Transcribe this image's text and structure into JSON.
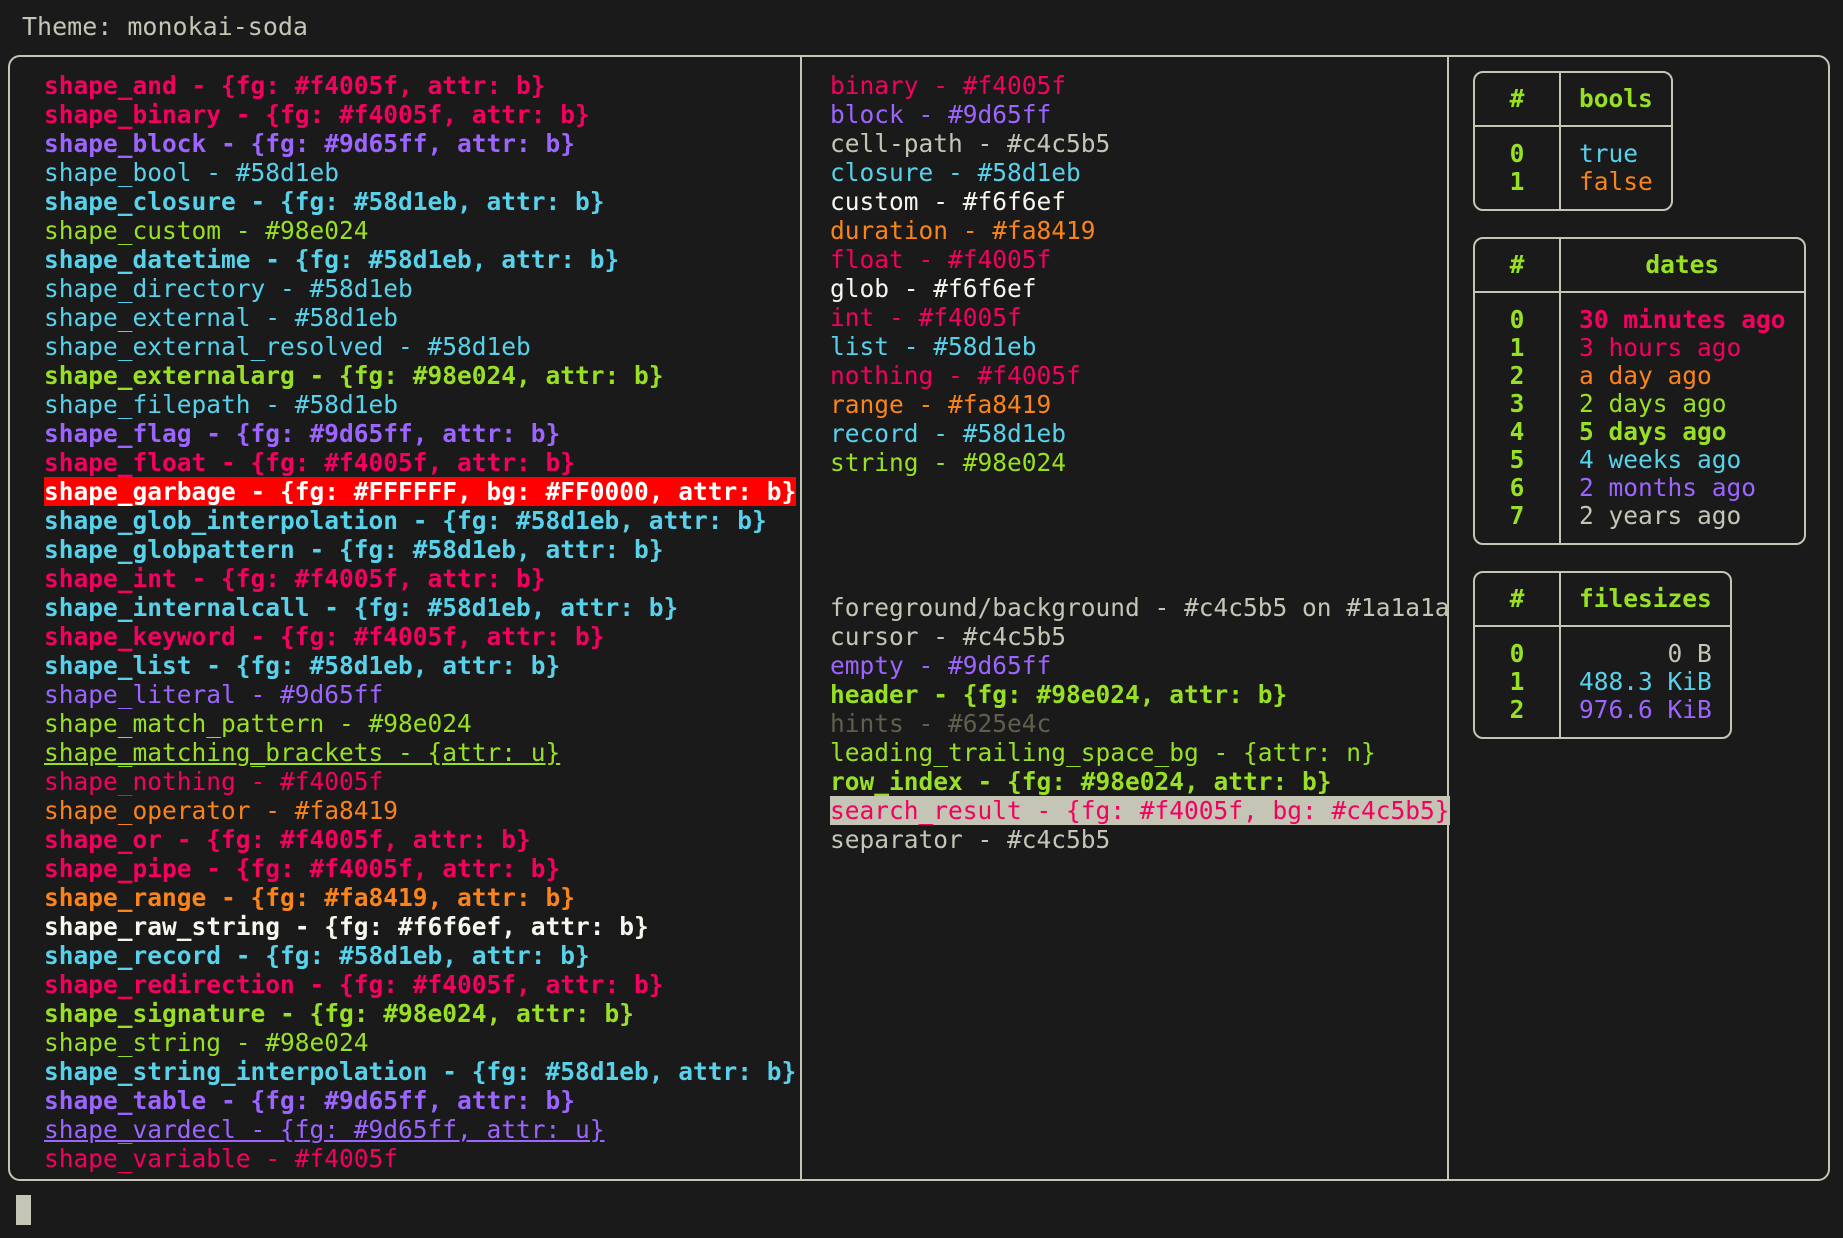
{
  "header": {
    "theme_label": "Theme: monokai-soda"
  },
  "colors": {
    "bg": "#1a1a1a",
    "fg": "#c4c5b5",
    "red": "#f4005f",
    "purple": "#9d65ff",
    "cyan": "#58d1eb",
    "green": "#98e024",
    "orange": "#fa8419",
    "white": "#f6f6ef",
    "hint_grey": "#625e4c",
    "garbage_fg": "#FFFFFF",
    "garbage_bg": "#FF0000"
  },
  "shapes_column": [
    {
      "name": "shape_and",
      "sep": " - ",
      "value": "{fg: #f4005f, attr: b}",
      "color": "red",
      "bold": true,
      "underline": false
    },
    {
      "name": "shape_binary",
      "sep": " - ",
      "value": "{fg: #f4005f, attr: b}",
      "color": "red",
      "bold": true,
      "underline": false
    },
    {
      "name": "shape_block",
      "sep": " - ",
      "value": "{fg: #9d65ff, attr: b}",
      "color": "purple",
      "bold": true,
      "underline": false
    },
    {
      "name": "shape_bool",
      "sep": " - ",
      "value": "#58d1eb",
      "color": "cyan",
      "bold": false,
      "underline": false
    },
    {
      "name": "shape_closure",
      "sep": " - ",
      "value": "{fg: #58d1eb, attr: b}",
      "color": "cyan",
      "bold": true,
      "underline": false
    },
    {
      "name": "shape_custom",
      "sep": " - ",
      "value": "#98e024",
      "color": "green",
      "bold": false,
      "underline": false
    },
    {
      "name": "shape_datetime",
      "sep": " - ",
      "value": "{fg: #58d1eb, attr: b}",
      "color": "cyan",
      "bold": true,
      "underline": false
    },
    {
      "name": "shape_directory",
      "sep": " - ",
      "value": "#58d1eb",
      "color": "cyan",
      "bold": false,
      "underline": false
    },
    {
      "name": "shape_external",
      "sep": " - ",
      "value": "#58d1eb",
      "color": "cyan",
      "bold": false,
      "underline": false
    },
    {
      "name": "shape_external_resolved",
      "sep": " - ",
      "value": "#58d1eb",
      "color": "cyan",
      "bold": false,
      "underline": false
    },
    {
      "name": "shape_externalarg",
      "sep": " - ",
      "value": "{fg: #98e024, attr: b}",
      "color": "green",
      "bold": true,
      "underline": false
    },
    {
      "name": "shape_filepath",
      "sep": " - ",
      "value": "#58d1eb",
      "color": "cyan",
      "bold": false,
      "underline": false
    },
    {
      "name": "shape_flag",
      "sep": " - ",
      "value": "{fg: #9d65ff, attr: b}",
      "color": "purple",
      "bold": true,
      "underline": false
    },
    {
      "name": "shape_float",
      "sep": " - ",
      "value": "{fg: #f4005f, attr: b}",
      "color": "red",
      "bold": true,
      "underline": false
    },
    {
      "name": "shape_garbage",
      "sep": " - ",
      "value": "{fg: #FFFFFF, bg: #FF0000, attr: b}",
      "color": "garbage",
      "bold": true,
      "underline": false
    },
    {
      "name": "shape_glob_interpolation",
      "sep": " - ",
      "value": "{fg: #58d1eb, attr: b}",
      "color": "cyan",
      "bold": true,
      "underline": false
    },
    {
      "name": "shape_globpattern",
      "sep": " - ",
      "value": "{fg: #58d1eb, attr: b}",
      "color": "cyan",
      "bold": true,
      "underline": false
    },
    {
      "name": "shape_int",
      "sep": " - ",
      "value": "{fg: #f4005f, attr: b}",
      "color": "red",
      "bold": true,
      "underline": false
    },
    {
      "name": "shape_internalcall",
      "sep": " - ",
      "value": "{fg: #58d1eb, attr: b}",
      "color": "cyan",
      "bold": true,
      "underline": false
    },
    {
      "name": "shape_keyword",
      "sep": " - ",
      "value": "{fg: #f4005f, attr: b}",
      "color": "red",
      "bold": true,
      "underline": false
    },
    {
      "name": "shape_list",
      "sep": " - ",
      "value": "{fg: #58d1eb, attr: b}",
      "color": "cyan",
      "bold": true,
      "underline": false
    },
    {
      "name": "shape_literal",
      "sep": " - ",
      "value": "#9d65ff",
      "color": "purple",
      "bold": false,
      "underline": false
    },
    {
      "name": "shape_match_pattern",
      "sep": " - ",
      "value": "#98e024",
      "color": "green",
      "bold": false,
      "underline": false
    },
    {
      "name": "shape_matching_brackets",
      "sep": " - ",
      "value": "{attr: u}",
      "color": "green",
      "bold": false,
      "underline": true
    },
    {
      "name": "shape_nothing",
      "sep": " - ",
      "value": "#f4005f",
      "color": "red",
      "bold": false,
      "underline": false
    },
    {
      "name": "shape_operator",
      "sep": " - ",
      "value": "#fa8419",
      "color": "orange",
      "bold": false,
      "underline": false
    },
    {
      "name": "shape_or",
      "sep": " - ",
      "value": "{fg: #f4005f, attr: b}",
      "color": "red",
      "bold": true,
      "underline": false
    },
    {
      "name": "shape_pipe",
      "sep": " - ",
      "value": "{fg: #f4005f, attr: b}",
      "color": "red",
      "bold": true,
      "underline": false
    },
    {
      "name": "shape_range",
      "sep": " - ",
      "value": "{fg: #fa8419, attr: b}",
      "color": "orange",
      "bold": true,
      "underline": false
    },
    {
      "name": "shape_raw_string",
      "sep": " - ",
      "value": "{fg: #f6f6ef, attr: b}",
      "color": "white",
      "bold": true,
      "underline": false
    },
    {
      "name": "shape_record",
      "sep": " - ",
      "value": "{fg: #58d1eb, attr: b}",
      "color": "cyan",
      "bold": true,
      "underline": false
    },
    {
      "name": "shape_redirection",
      "sep": " - ",
      "value": "{fg: #f4005f, attr: b}",
      "color": "red",
      "bold": true,
      "underline": false
    },
    {
      "name": "shape_signature",
      "sep": " - ",
      "value": "{fg: #98e024, attr: b}",
      "color": "green",
      "bold": true,
      "underline": false
    },
    {
      "name": "shape_string",
      "sep": " - ",
      "value": "#98e024",
      "color": "green",
      "bold": false,
      "underline": false
    },
    {
      "name": "shape_string_interpolation",
      "sep": " - ",
      "value": "{fg: #58d1eb, attr: b}",
      "color": "cyan",
      "bold": true,
      "underline": false
    },
    {
      "name": "shape_table",
      "sep": " - ",
      "value": "{fg: #9d65ff, attr: b}",
      "color": "purple",
      "bold": true,
      "underline": false
    },
    {
      "name": "shape_vardecl",
      "sep": " - ",
      "value": "{fg: #9d65ff, attr: u}",
      "color": "purple",
      "bold": false,
      "underline": true
    },
    {
      "name": "shape_variable",
      "sep": " - ",
      "value": "#f4005f",
      "color": "red",
      "bold": false,
      "underline": false
    }
  ],
  "types_column": [
    {
      "name": "binary",
      "sep": " - ",
      "value": "#f4005f",
      "color": "red",
      "bold": false,
      "underline": false
    },
    {
      "name": "block",
      "sep": " - ",
      "value": "#9d65ff",
      "color": "purple",
      "bold": false,
      "underline": false
    },
    {
      "name": "cell-path",
      "sep": " - ",
      "value": "#c4c5b5",
      "color": "fg",
      "bold": false,
      "underline": false
    },
    {
      "name": "closure",
      "sep": " - ",
      "value": "#58d1eb",
      "color": "cyan",
      "bold": false,
      "underline": false
    },
    {
      "name": "custom",
      "sep": " - ",
      "value": "#f6f6ef",
      "color": "white",
      "bold": false,
      "underline": false
    },
    {
      "name": "duration",
      "sep": " - ",
      "value": "#fa8419",
      "color": "orange",
      "bold": false,
      "underline": false
    },
    {
      "name": "float",
      "sep": " - ",
      "value": "#f4005f",
      "color": "red",
      "bold": false,
      "underline": false
    },
    {
      "name": "glob",
      "sep": " - ",
      "value": "#f6f6ef",
      "color": "white",
      "bold": false,
      "underline": false
    },
    {
      "name": "int",
      "sep": " - ",
      "value": "#f4005f",
      "color": "red",
      "bold": false,
      "underline": false
    },
    {
      "name": "list",
      "sep": " - ",
      "value": "#58d1eb",
      "color": "cyan",
      "bold": false,
      "underline": false
    },
    {
      "name": "nothing",
      "sep": " - ",
      "value": "#f4005f",
      "color": "red",
      "bold": false,
      "underline": false
    },
    {
      "name": "range",
      "sep": " - ",
      "value": "#fa8419",
      "color": "orange",
      "bold": false,
      "underline": false
    },
    {
      "name": "record",
      "sep": " - ",
      "value": "#58d1eb",
      "color": "cyan",
      "bold": false,
      "underline": false
    },
    {
      "name": "string",
      "sep": " - ",
      "value": "#98e024",
      "color": "green",
      "bold": false,
      "underline": false
    }
  ],
  "ui_column": [
    {
      "name": "foreground/background",
      "sep": " - ",
      "value": "#c4c5b5 on #1a1a1a",
      "color": "fg",
      "bold": false,
      "underline": false
    },
    {
      "name": "cursor",
      "sep": " - ",
      "value": "#c4c5b5",
      "color": "fg",
      "bold": false,
      "underline": false
    },
    {
      "name": "empty",
      "sep": " - ",
      "value": "#9d65ff",
      "color": "purple",
      "bold": false,
      "underline": false
    },
    {
      "name": "header",
      "sep": " - ",
      "value": "{fg: #98e024, attr: b}",
      "color": "green",
      "bold": true,
      "underline": false
    },
    {
      "name": "hints",
      "sep": " - ",
      "value": "#625e4c",
      "color": "hint",
      "bold": false,
      "underline": false
    },
    {
      "name": "leading_trailing_space_bg",
      "sep": " - ",
      "value": "{attr: n}",
      "color": "green",
      "bold": false,
      "underline": false
    },
    {
      "name": "row_index",
      "sep": " - ",
      "value": "{fg: #98e024, attr: b}",
      "color": "green",
      "bold": true,
      "underline": false
    },
    {
      "name": "search_result",
      "sep": " - ",
      "value": "{fg: #f4005f, bg: #c4c5b5}",
      "color": "search",
      "bold": false,
      "underline": false
    },
    {
      "name": "separator",
      "sep": " - ",
      "value": "#c4c5b5",
      "color": "fg",
      "bold": false,
      "underline": false
    }
  ],
  "tables": [
    {
      "id": "bools",
      "index_header": "#",
      "value_header": "bools",
      "align": "left",
      "rows": [
        {
          "index": "0",
          "value": "true",
          "color": "cyan",
          "bold": false
        },
        {
          "index": "1",
          "value": "false",
          "color": "orange",
          "bold": false
        }
      ]
    },
    {
      "id": "dates",
      "index_header": "#",
      "value_header": "dates",
      "align": "left",
      "rows": [
        {
          "index": "0",
          "value": "30 minutes ago",
          "color": "red",
          "bold": true
        },
        {
          "index": "1",
          "value": "3 hours ago",
          "color": "red",
          "bold": false
        },
        {
          "index": "2",
          "value": "a day ago",
          "color": "orange",
          "bold": false
        },
        {
          "index": "3",
          "value": "2 days ago",
          "color": "green",
          "bold": false
        },
        {
          "index": "4",
          "value": "5 days ago",
          "color": "green",
          "bold": true
        },
        {
          "index": "5",
          "value": "4 weeks ago",
          "color": "cyan",
          "bold": false
        },
        {
          "index": "6",
          "value": "2 months ago",
          "color": "purple",
          "bold": false
        },
        {
          "index": "7",
          "value": "2 years ago",
          "color": "fg",
          "bold": false
        }
      ]
    },
    {
      "id": "filesizes",
      "index_header": "#",
      "value_header": "filesizes",
      "align": "right",
      "rows": [
        {
          "index": "0",
          "value": "0 B",
          "color": "fg",
          "bold": false
        },
        {
          "index": "1",
          "value": "488.3 KiB",
          "color": "cyan",
          "bold": false
        },
        {
          "index": "2",
          "value": "976.6 KiB",
          "color": "purple",
          "bold": false
        }
      ]
    }
  ]
}
